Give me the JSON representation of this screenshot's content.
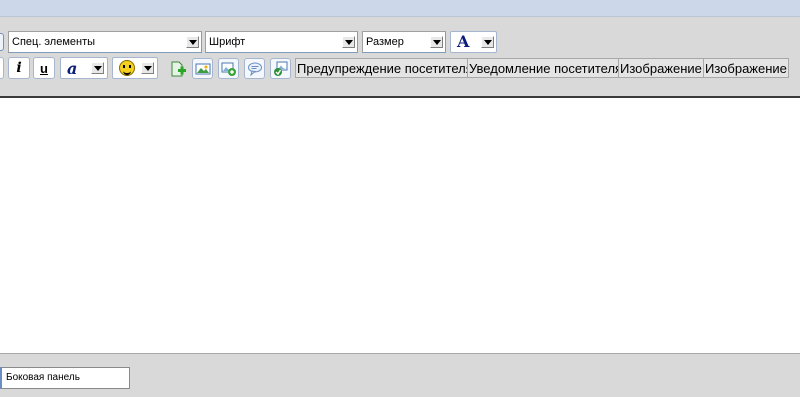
{
  "toolbar": {
    "special_elements": "Спец. элементы",
    "font": "Шрифт",
    "size": "Размер",
    "font_color_glyph": "A",
    "italic_label": "i",
    "underline_label": "u",
    "font_style_glyph": "a",
    "insert_buttons": [
      {
        "label": "Предупреждение посетителя"
      },
      {
        "label": "Уведомление посетителя"
      },
      {
        "label": "Изображение"
      },
      {
        "label": "Изображение"
      }
    ]
  },
  "footer": {
    "side_panel": "Боковая панель"
  },
  "colors": {
    "topbar": "#ccd7ea",
    "toolbar_bg": "#d9d9d9",
    "editor_bg": "#ffffff",
    "accent_blue": "#0b1f7a"
  },
  "icons": [
    "add-green-icon",
    "image-icon",
    "image-add-icon",
    "speech-bubble-icon",
    "image-settings-icon",
    "smiley-icon"
  ]
}
